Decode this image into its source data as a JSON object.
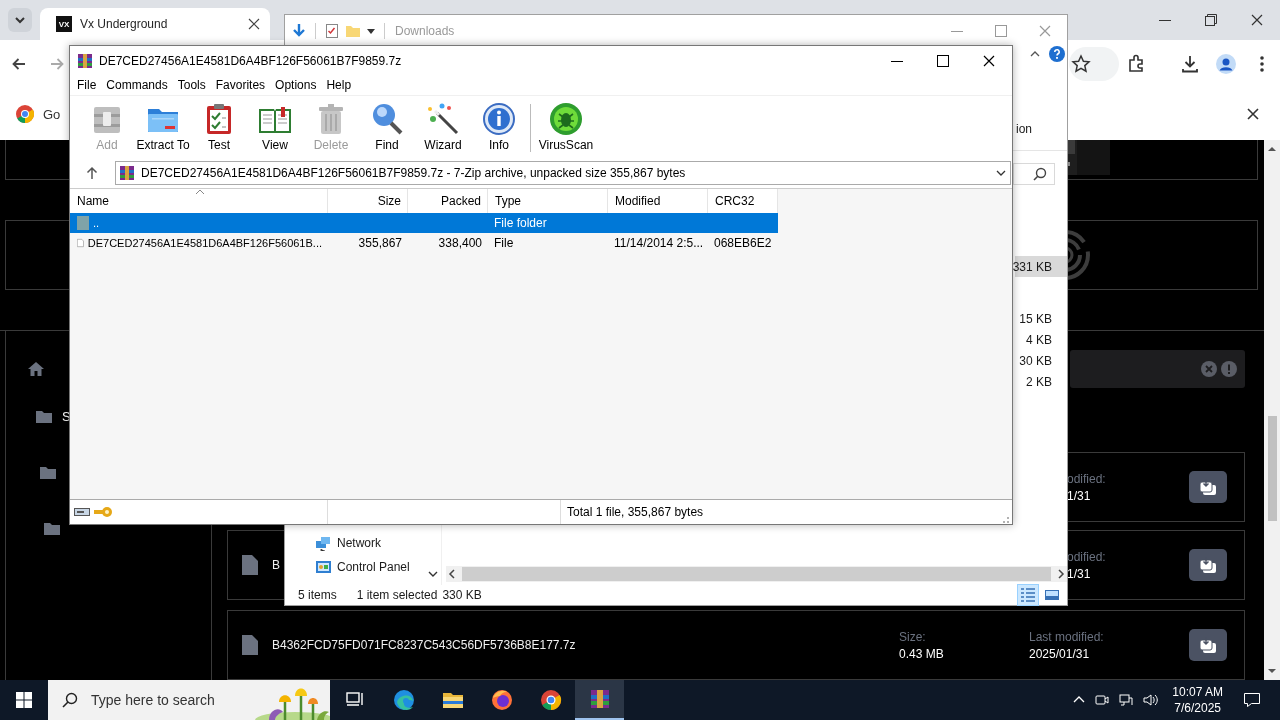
{
  "browser": {
    "tabs": [
      {
        "logo": "VX",
        "title": "Vx Underground",
        "selected": true
      }
    ],
    "infobar": {
      "text": "Go"
    },
    "page": {
      "tree": [
        {
          "kind": "folder",
          "label": "S",
          "children": [
            {
              "kind": "folder",
              "children": [
                {
                  "kind": "folder"
                }
              ]
            }
          ]
        }
      ],
      "files": [
        {
          "kind": "clipped",
          "modified_label": "odified:",
          "modified": "1/31"
        },
        {
          "kind": "clipped",
          "name": "B",
          "modified_label": "odified:",
          "modified": "1/31"
        },
        {
          "kind": "full",
          "name": "B4362FCD75FD071FC8237C543C56DF5736B8E177.7z",
          "size_label": "Size:",
          "size": "0.43 MB",
          "modified_label": "Last modified:",
          "modified": "2025/01/31"
        }
      ]
    }
  },
  "explorer": {
    "title": "Downloads",
    "ribbon_text": "ion",
    "items": [
      {
        "size": "331 KB",
        "selected": true
      },
      {
        "size": "15 KB",
        "selected": false
      },
      {
        "size": "4 KB",
        "selected": false
      },
      {
        "size": "30 KB",
        "selected": false
      },
      {
        "size": "2 KB",
        "selected": false
      }
    ],
    "nav": [
      {
        "kind": "network",
        "label": "Network"
      },
      {
        "kind": "control",
        "label": "Control Panel"
      }
    ],
    "status": [
      "5 items",
      "1 item selected",
      "330 KB"
    ],
    "views": [
      {
        "kind": "details",
        "selected": true
      },
      {
        "kind": "tiles",
        "selected": false
      }
    ]
  },
  "archive": {
    "title": "DE7CED27456A1E4581D6A4BF126F56061B7F9859.7z",
    "menu": [
      "File",
      "Commands",
      "Tools",
      "Favorites",
      "Options",
      "Help"
    ],
    "tools": [
      {
        "kind": "add",
        "label": "Add",
        "disabled": true
      },
      {
        "kind": "extract",
        "label": "Extract To",
        "disabled": false
      },
      {
        "kind": "test",
        "label": "Test",
        "disabled": false
      },
      {
        "kind": "view",
        "label": "View",
        "disabled": false
      },
      {
        "kind": "delete",
        "label": "Delete",
        "disabled": true
      },
      {
        "kind": "find",
        "label": "Find",
        "disabled": false
      },
      {
        "kind": "wizard",
        "label": "Wizard",
        "disabled": false
      },
      {
        "kind": "info",
        "label": "Info",
        "disabled": false
      },
      {
        "kind": "scan",
        "label": "VirusScan",
        "disabled": false
      }
    ],
    "path": "DE7CED27456A1E4581D6A4BF126F56061B7F9859.7z - 7-Zip archive, unpacked size 355,867 bytes",
    "columns": [
      "Name",
      "Size",
      "Packed",
      "Type",
      "Modified",
      "CRC32"
    ],
    "rows": [
      {
        "kind": "folder",
        "name": "..",
        "type": "File folder",
        "selected": true
      },
      {
        "kind": "file",
        "name": "DE7CED27456A1E4581D6A4BF126F56061B...",
        "size": "355,867",
        "packed": "338,400",
        "type": "File",
        "modified": "11/14/2014 2:5...",
        "crc": "068EB6E2",
        "selected": false
      }
    ],
    "status": "Total 1 file, 355,867 bytes"
  },
  "taskbar": {
    "search": {
      "placeholder": "Type here to search"
    },
    "apps": [
      {
        "kind": "taskview",
        "active": false
      },
      {
        "kind": "edge",
        "active": false
      },
      {
        "kind": "files",
        "active": false
      },
      {
        "kind": "firefox",
        "active": false
      },
      {
        "kind": "chrome",
        "active": false
      },
      {
        "kind": "archiver",
        "active": true
      }
    ],
    "time": "10:07 AM",
    "date": "7/6/2025"
  }
}
